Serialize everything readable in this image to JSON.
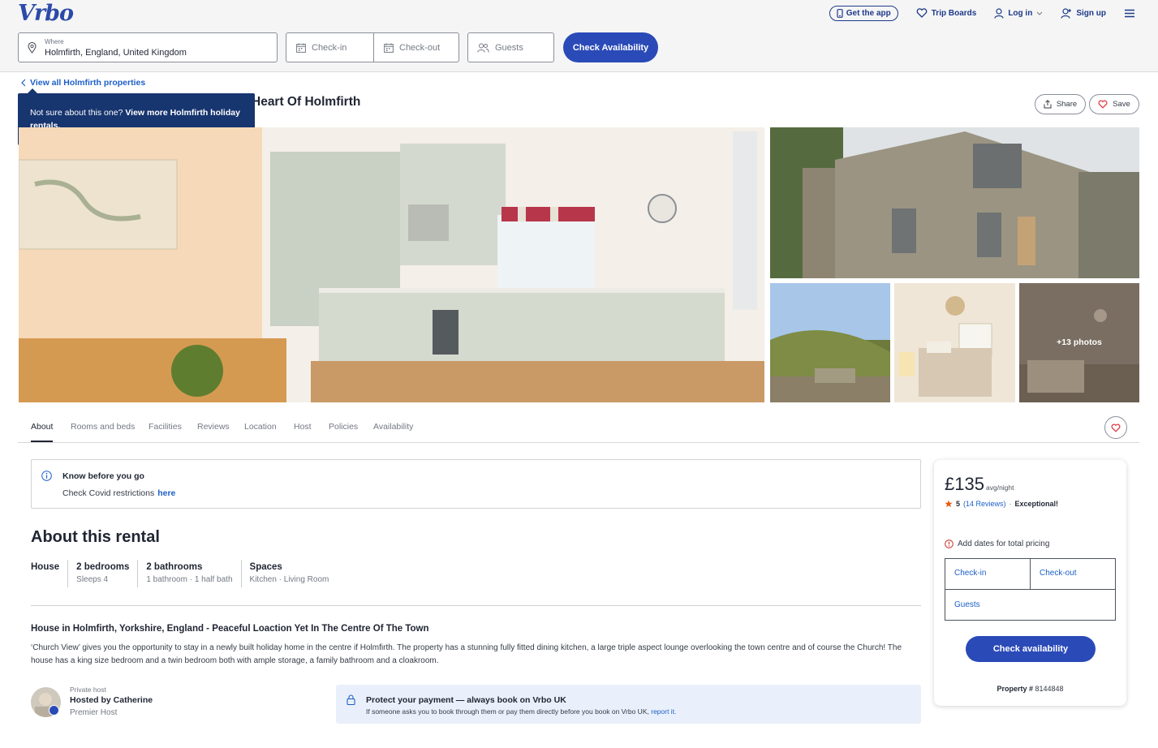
{
  "brand": {
    "logo_text": "Vrbo"
  },
  "header": {
    "get_app": "Get the app",
    "trip_boards": "Trip Boards",
    "log_in": "Log in",
    "sign_up": "Sign up"
  },
  "search": {
    "where_label": "Where",
    "where_value": "Holmfirth, England, United Kingdom",
    "checkin_placeholder": "Check-in",
    "checkout_placeholder": "Check-out",
    "guests_placeholder": "Guests",
    "button": "Check Availability"
  },
  "breadcrumb": {
    "back_link": "View all Holmfirth properties"
  },
  "tooltip": {
    "text": "Not sure about this one?",
    "bold": "View more Holmfirth holiday rentals."
  },
  "listing": {
    "title_visible": "Heart Of Holmfirth",
    "share": "Share",
    "save": "Save"
  },
  "gallery": {
    "more_label": "+13 photos"
  },
  "tabs": [
    {
      "label": "About"
    },
    {
      "label": "Rooms and beds"
    },
    {
      "label": "Facilities"
    },
    {
      "label": "Reviews"
    },
    {
      "label": "Location"
    },
    {
      "label": "Host"
    },
    {
      "label": "Policies"
    },
    {
      "label": "Availability"
    }
  ],
  "know_before": {
    "title": "Know before you go",
    "text": "Check Covid restrictions",
    "link": "here"
  },
  "about": {
    "heading": "About this rental",
    "facts": [
      {
        "title": "House",
        "sub": ""
      },
      {
        "title": "2 bedrooms",
        "sub": "Sleeps 4"
      },
      {
        "title": "2 bathrooms",
        "sub": "1 bathroom  ·  1 half bath"
      },
      {
        "title": "Spaces",
        "sub": "Kitchen  ·  Living Room"
      }
    ],
    "house_heading": "House in Holmfirth, Yorkshire, England - Peaceful Loaction Yet In The Centre Of The Town",
    "description": "‘Church View’ gives you the opportunity to stay in a newly built holiday home in the centre if Holmfirth. The property has a stunning fully fitted dining kitchen, a large triple aspect lounge overlooking the town centre and of course the Church! The house has a king size bedroom and a twin bedroom both with ample storage, a family bathroom and a cloakroom."
  },
  "host": {
    "type": "Private host",
    "name": "Hosted by Catherine",
    "tag": "Premier Host"
  },
  "protect": {
    "title": "Protect your payment — always book on Vrbo UK",
    "text": "If someone asks you to book through them or pay them directly before you book on Vrbo UK,",
    "link": "report it."
  },
  "pricing": {
    "price": "£135",
    "per": "avg/night",
    "rating": "5",
    "reviews": "(14 Reviews)",
    "dot": "·",
    "rating_word": "Exceptional!",
    "add_dates": "Add dates for total pricing",
    "checkin": "Check-in",
    "checkout": "Check-out",
    "guests": "Guests",
    "button": "Check availability",
    "property_label": "Property #",
    "property_number": "8144848"
  },
  "colors": {
    "brand_blue": "#2a4ab8",
    "link_blue": "#1d5fc7",
    "tooltip_navy": "#17356f",
    "star_orange": "#e8590c"
  }
}
